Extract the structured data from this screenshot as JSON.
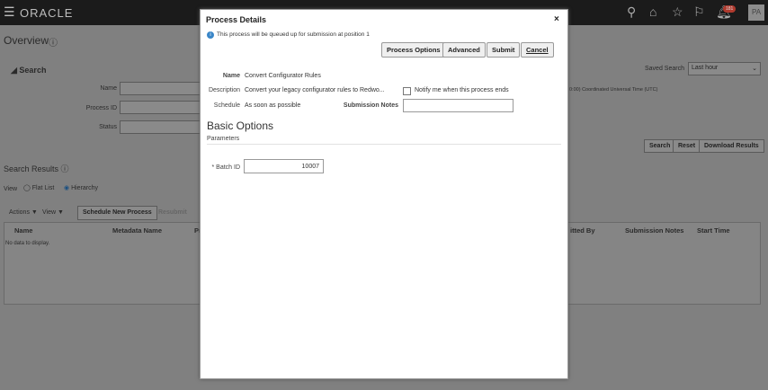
{
  "header": {
    "brand": "ORACLE",
    "notification_count": "181",
    "avatar": "PA"
  },
  "page": {
    "title": "Overview",
    "search_title": "Search",
    "fields": {
      "name": "Name",
      "process_id": "Process ID",
      "status": "Status"
    },
    "saved_search_label": "Saved Search",
    "saved_search_value": "Last hour",
    "timezone": "0:00) Coordinated Universal Time (UTC)",
    "search_btn": "Search",
    "reset_btn": "Reset",
    "download_btn": "Download Results",
    "results_title": "Search Results",
    "view_label": "View",
    "flat_list": "Flat List",
    "hierarchy": "Hierarchy",
    "actions": "Actions ▼",
    "view_menu": "View ▼",
    "schedule_btn": "Schedule New Process",
    "resubmit_btn": "Resubmit",
    "columns": [
      "Name",
      "Metadata Name",
      "Pr",
      "itted By",
      "Submission Notes",
      "Start Time"
    ],
    "empty": "No data to display."
  },
  "dialog": {
    "title": "Process Details",
    "info": "This process will be queued up for submission at position 1",
    "buttons": {
      "process_options": "Process Options",
      "advanced": "Advanced",
      "submit": "Submit",
      "cancel": "Cancel"
    },
    "name_label": "Name",
    "name_value": "Convert Configurator Rules",
    "desc_label": "Description",
    "desc_value": "Convert your legacy configurator rules to Redwo...",
    "notify_label": "Notify me when this process ends",
    "schedule_label": "Schedule",
    "schedule_value": "As soon as possible",
    "notes_label": "Submission Notes",
    "notes_value": "",
    "section": "Basic Options",
    "params": "Parameters",
    "batch_label": "* Batch ID",
    "batch_value": "10007"
  }
}
